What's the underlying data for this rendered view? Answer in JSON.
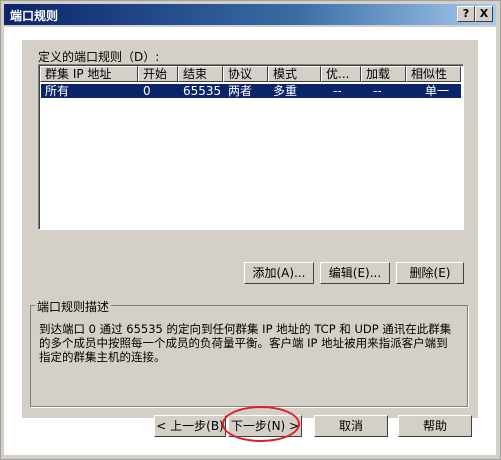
{
  "window": {
    "title": "端口规则"
  },
  "titlebar_buttons": {
    "help": "?",
    "close": "X"
  },
  "list": {
    "label": "定义的端口规则（D）:",
    "columns": [
      "群集 IP 地址",
      "开始",
      "结束",
      "协议",
      "模式",
      "优...",
      "加载",
      "相似性"
    ],
    "rows": [
      [
        "所有",
        "0",
        "65535",
        "两者",
        "多重",
        "--",
        "--",
        "单一"
      ]
    ]
  },
  "actions": {
    "add": "添加(A)...",
    "edit": "编辑(E)...",
    "delete": "删除(E)"
  },
  "description": {
    "title": "端口规则描述",
    "text": "到达端口 0 通过 65535 的定向到任何群集 IP 地址的 TCP 和 UDP 通讯在此群集的多个成员中按照每一个成员的负荷量平衡。客户端 IP 地址被用来指派客户端到指定的群集主机的连接。"
  },
  "nav": {
    "back": "< 上一步(B)",
    "next": "下一步(N) >",
    "cancel": "取消",
    "help": "帮助"
  },
  "highlight_color": "#e21d2b",
  "selection_color": "#0a246a"
}
